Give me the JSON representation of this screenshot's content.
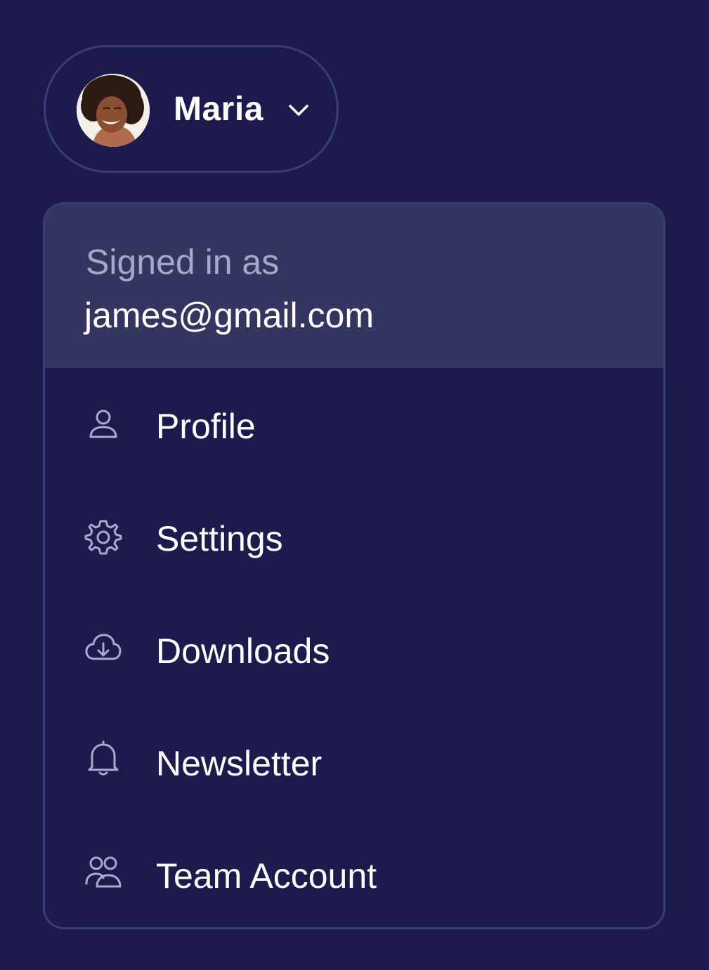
{
  "user": {
    "name": "Maria",
    "avatar_icon": "avatar-photo",
    "dropdown_icon": "chevron-down-icon"
  },
  "menu": {
    "header": {
      "label": "Signed in as",
      "email": "james@gmail.com"
    },
    "items": [
      {
        "label": "Profile",
        "icon": "user-icon"
      },
      {
        "label": "Settings",
        "icon": "gear-icon"
      },
      {
        "label": "Downloads",
        "icon": "cloud-download-icon"
      },
      {
        "label": "Newsletter",
        "icon": "bell-icon"
      },
      {
        "label": "Team Account",
        "icon": "users-icon"
      }
    ]
  },
  "colors": {
    "background": "#1d1b4e",
    "header_background": "#353562",
    "border": "#3a3d78",
    "text_primary": "#ffffff",
    "text_muted": "#a6a8c7",
    "icon": "#a9aacc"
  }
}
